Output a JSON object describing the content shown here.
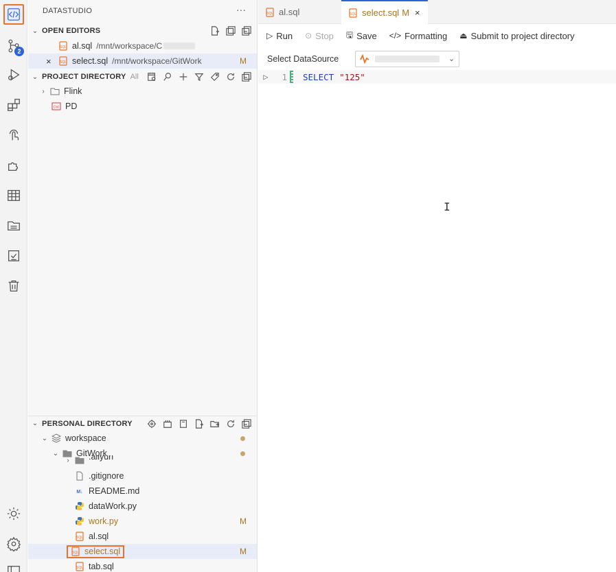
{
  "activity_bar": {
    "items": [
      {
        "name": "datastudio-icon",
        "active": true
      },
      {
        "name": "git-branch-icon",
        "badge": "2"
      },
      {
        "name": "run-debug-icon"
      },
      {
        "name": "extensions-icon"
      },
      {
        "name": "touch-icon"
      },
      {
        "name": "puzzle-icon"
      },
      {
        "name": "table-icon"
      },
      {
        "name": "folder-icon"
      },
      {
        "name": "checklist-icon"
      },
      {
        "name": "trash-icon"
      },
      {
        "name": "sun-icon"
      },
      {
        "name": "settings-icon"
      }
    ]
  },
  "side": {
    "title": "DATASTUDIO",
    "more": "···",
    "open_editors": {
      "label": "OPEN EDITORS",
      "items": [
        {
          "name": "al.sql",
          "path": "/mnt/workspace/C"
        },
        {
          "name": "select.sql",
          "path": "/mnt/workspace/GitWork",
          "mod": "M"
        }
      ]
    },
    "project_directory": {
      "label": "PROJECT DIRECTORY",
      "extra": "All",
      "items": [
        {
          "name": "Flink"
        },
        {
          "name": "PD"
        }
      ]
    },
    "personal_directory": {
      "label": "PERSONAL DIRECTORY",
      "items": [
        {
          "name": "workspace"
        },
        {
          "name": "GitWork"
        },
        {
          "name": ".aliyun"
        },
        {
          "name": ".gitignore"
        },
        {
          "name": "README.md"
        },
        {
          "name": "dataWork.py"
        },
        {
          "name": "work.py",
          "mod": "M"
        },
        {
          "name": "al.sql"
        },
        {
          "name": "select.sql",
          "mod": "M"
        },
        {
          "name": "tab.sql"
        }
      ]
    }
  },
  "editor": {
    "tabs": [
      {
        "label": "al.sql"
      },
      {
        "label": "select.sql",
        "mod": "M",
        "close": "×"
      }
    ],
    "toolbar": {
      "run": "Run",
      "stop": "Stop",
      "save": "Save",
      "formatting": "Formatting",
      "submit": "Submit to project directory"
    },
    "datasource": {
      "label": "Select DataSource"
    },
    "code": {
      "line_no": "1",
      "keyword": "SELECT",
      "string": "\"125\""
    }
  },
  "colors": {
    "accent": "#2c63d6",
    "highlight": "#e8742a",
    "modified": "#a8771f",
    "keyword": "#1f3cc7",
    "string": "#a31515"
  }
}
